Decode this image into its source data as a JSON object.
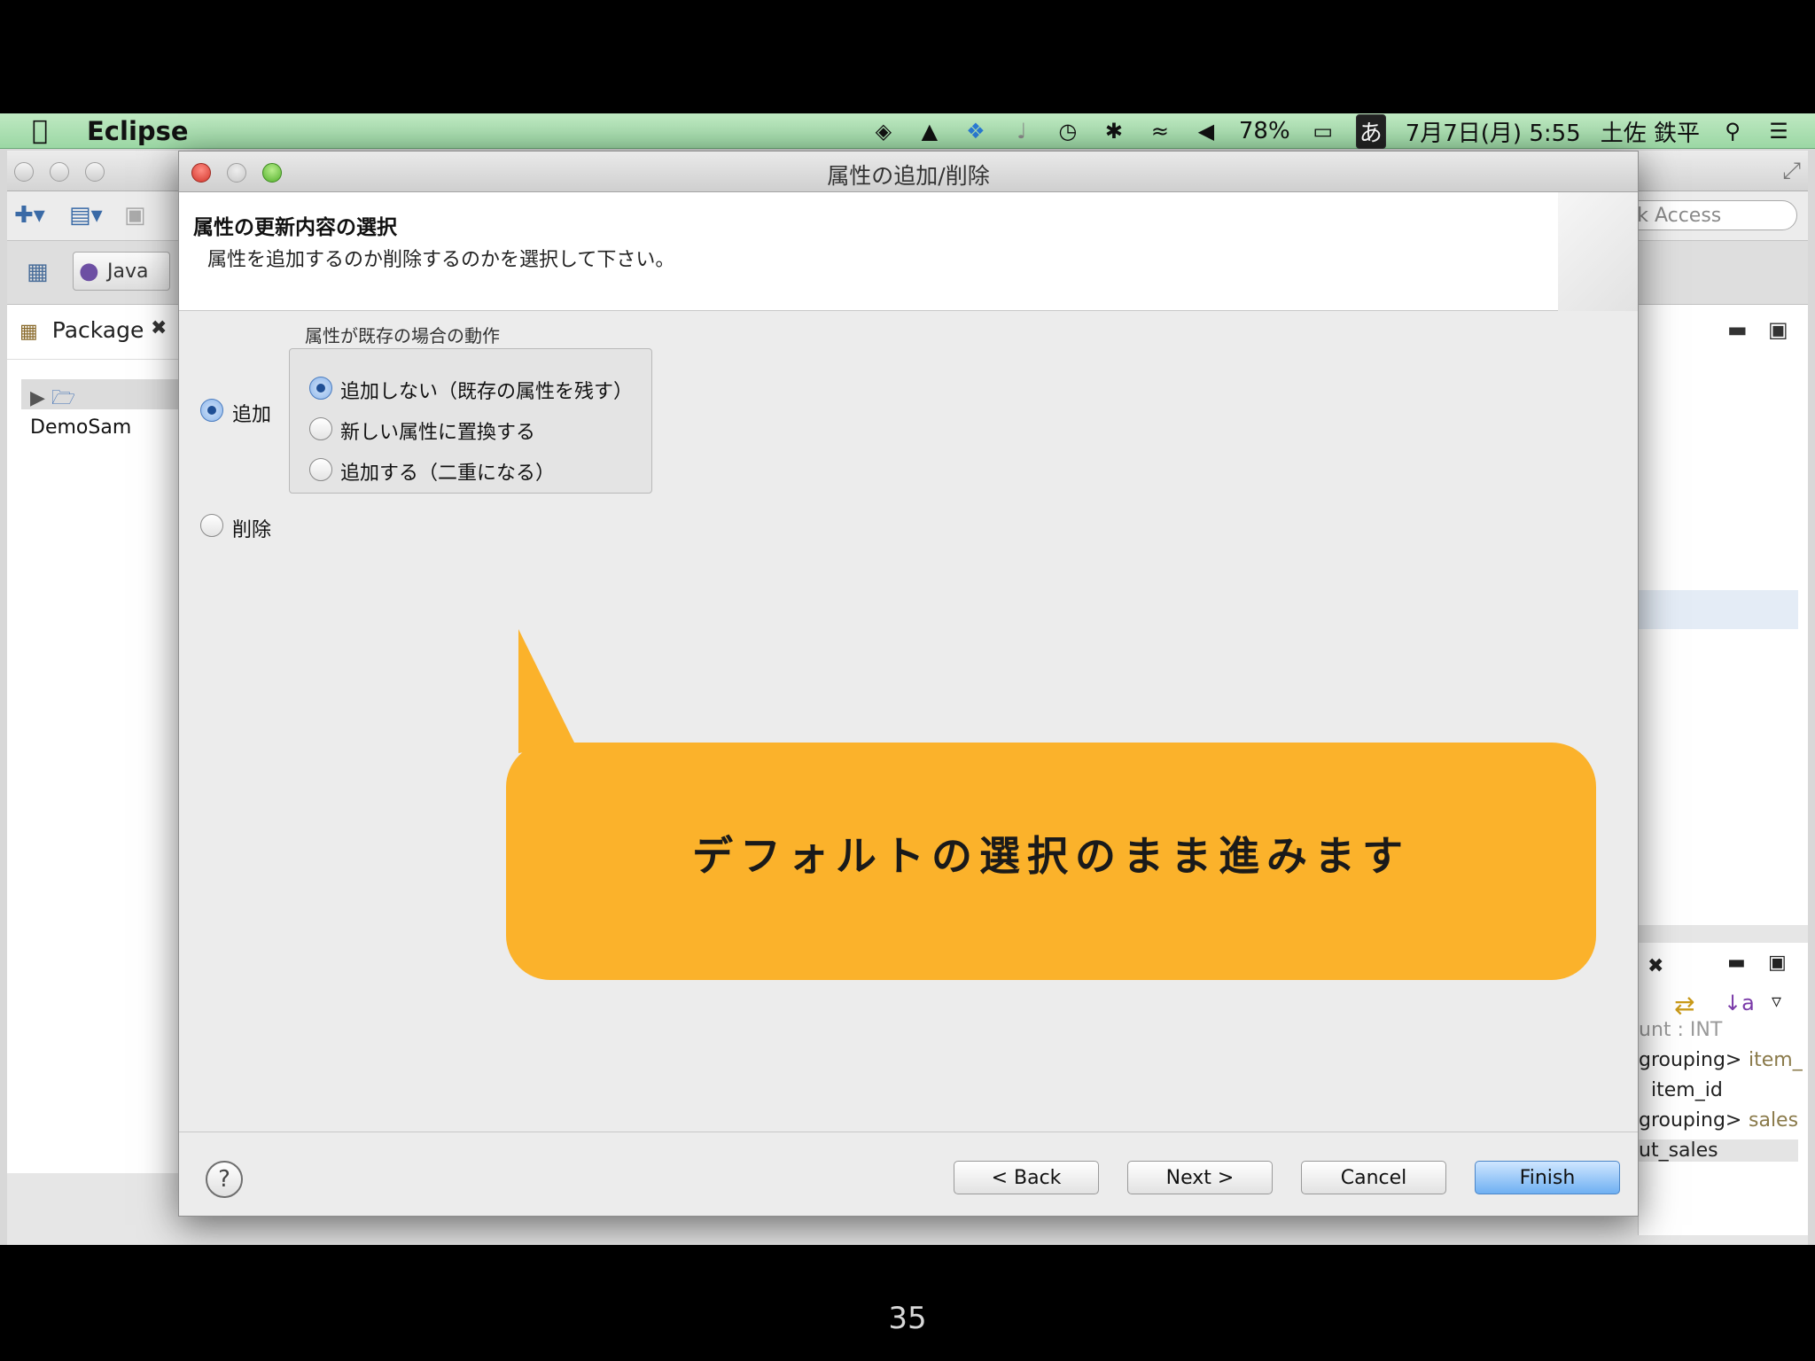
{
  "menubar": {
    "apple_icon": "apple-icon",
    "app_name": "Eclipse",
    "battery": "78%",
    "input_method": "あ",
    "datetime": "7月7日(月) 5:55",
    "user": "土佐 鉄平"
  },
  "eclipse": {
    "quick_access_placeholder": "Quick Access",
    "quick_access_visible": "ick Access",
    "perspective_java": "Java",
    "package_tab": "Package",
    "tree_item": "DemoSam"
  },
  "outline": {
    "rows": [
      "unt : INT",
      "grouping>",
      "item_",
      "item_id",
      "grouping>",
      "sales",
      "ut_sales"
    ]
  },
  "dialog": {
    "title": "属性の追加/削除",
    "header_title": "属性の更新内容の選択",
    "header_desc": "属性を追加するのか削除するのかを選択して下さい。",
    "option_add": "追加",
    "option_delete": "削除",
    "group_title": "属性が既存の場合の動作",
    "group_options": [
      "追加しない（既存の属性を残す）",
      "新しい属性に置換する",
      "追加する（二重になる）"
    ],
    "buttons": {
      "back": "< Back",
      "next": "Next >",
      "cancel": "Cancel",
      "finish": "Finish"
    },
    "help": "?"
  },
  "callout": {
    "text": "デフォルトの選択のまま進みます",
    "color": "#fbb22b"
  },
  "slide": {
    "page_number": "35"
  }
}
